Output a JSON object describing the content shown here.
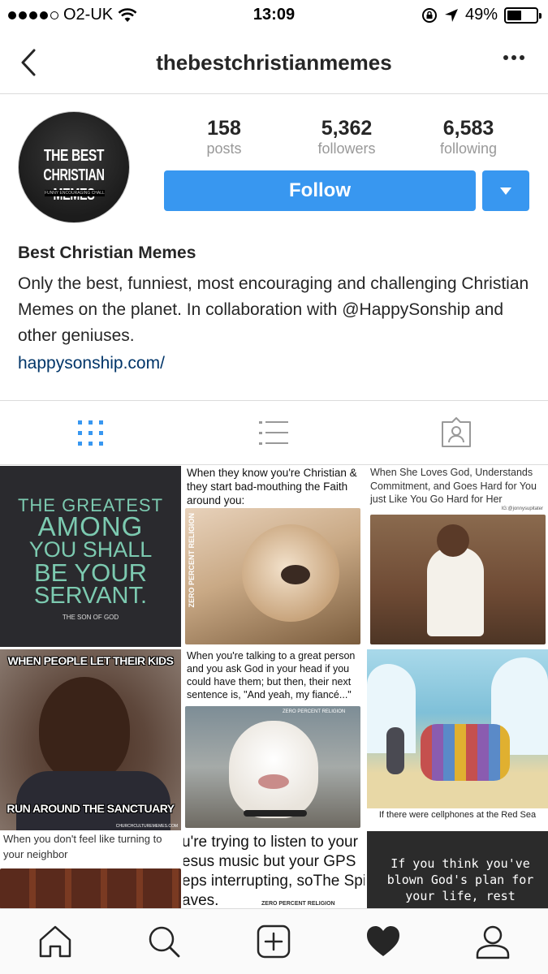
{
  "status_bar": {
    "carrier": "O2-UK",
    "time": "13:09",
    "battery": "49%",
    "battery_level": 0.49,
    "icons": [
      "signal-dots",
      "wifi-icon",
      "rotation-lock-icon",
      "location-arrow-icon",
      "battery-icon"
    ]
  },
  "nav": {
    "title": "thebestchristianmemes",
    "back_icon": "chevron-left-icon",
    "more_icon": "more-dots-icon"
  },
  "profile": {
    "avatar": {
      "line1": "THE BEST",
      "line2": "CHRISTIAN MEMES",
      "tagline": "FUNNY ENCOURAGING CHALLENGING"
    },
    "stats": [
      {
        "value": "158",
        "label": "posts"
      },
      {
        "value": "5,362",
        "label": "followers"
      },
      {
        "value": "6,583",
        "label": "following"
      }
    ],
    "follow_label": "Follow",
    "accent_color": "#3897f0",
    "name": "Best Christian Memes",
    "bio": "Only the best, funniest, most encouraging and challenging Christian Memes on the planet. In collaboration with @HappySonship and other geniuses.",
    "link": "happysonship.com/"
  },
  "tabs": [
    {
      "name": "grid-view-icon",
      "active": true
    },
    {
      "name": "list-view-icon",
      "active": false
    },
    {
      "name": "tagged-photos-icon",
      "active": false
    }
  ],
  "posts": {
    "p1": {
      "line1": "THE GREATEST",
      "line2": "AMONG",
      "line3": "YOU SHALL",
      "line4": "BE YOUR",
      "line5": "SERVANT.",
      "credit": "THE SON OF GOD"
    },
    "p2": {
      "caption": "When they know you're Christian & they start bad-mouthing the Faith around you:",
      "watermark": "ZERO PERCENT RELIGION"
    },
    "p3": {
      "caption": "When She Loves God, Understands Commitment, and Goes Hard for You just Like You Go Hard for Her",
      "credit": "IG:@jonnysupitater"
    },
    "p4": {
      "top": "WHEN PEOPLE LET THEIR KIDS",
      "bottom": "RUN AROUND THE SANCTUARY",
      "credit": "CHURCHCULTUREMEMES.COM"
    },
    "p5": {
      "caption": "When you're talking to a great person and you ask God in your head if you could have them; but then, their next sentence is, \"And yeah, my fiancé...\"",
      "watermark": "ZERO PERCENT RELIGION"
    },
    "p6": {
      "caption": "If there were cellphones at the Red Sea"
    },
    "p7": {
      "caption": "When you don't feel like turning to your neighbor"
    },
    "p8": {
      "caption": "u're trying to listen to your esus music but your GPS eps interrupting, soThe Spi aves.",
      "watermark": "ZERO PERCENT RELIGION"
    },
    "p9": {
      "caption": "If you think you've blown God's plan for your life, rest"
    }
  },
  "bottom_bar": [
    "home-icon",
    "search-icon",
    "new-post-icon",
    "activity-heart-icon",
    "profile-icon"
  ]
}
